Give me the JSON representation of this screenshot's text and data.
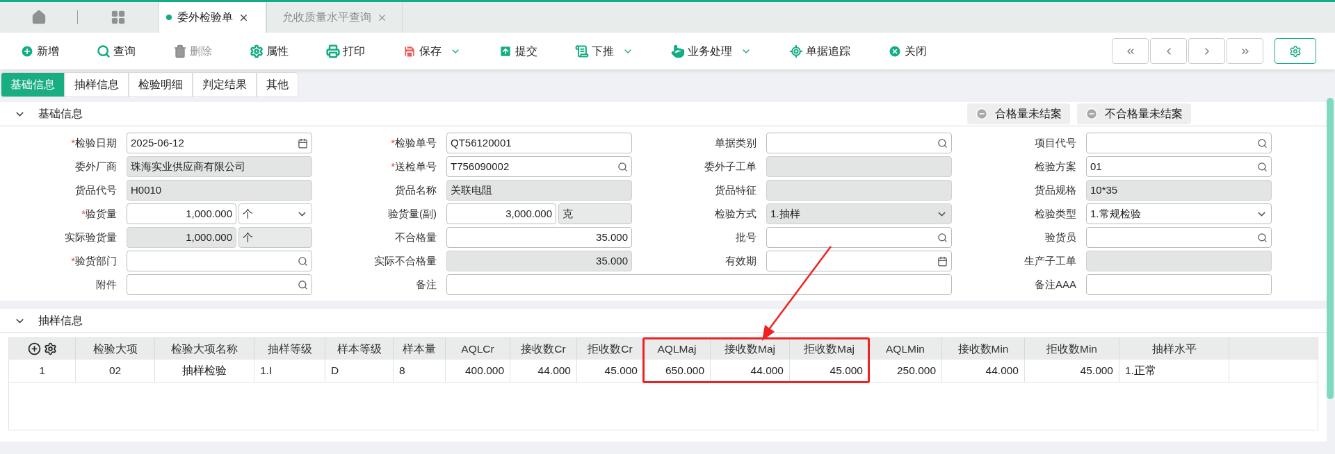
{
  "tabs": [
    {
      "label": "委外检验单",
      "selected": true,
      "closable": true
    },
    {
      "label": "允收质量水平查询",
      "selected": false,
      "closable": true
    }
  ],
  "toolbar": [
    {
      "label": "新增",
      "disabled": false,
      "dropdown": false
    },
    {
      "label": "查询",
      "disabled": false,
      "dropdown": false
    },
    {
      "label": "删除",
      "disabled": true,
      "dropdown": false
    },
    {
      "label": "属性",
      "disabled": false,
      "dropdown": false
    },
    {
      "label": "打印",
      "disabled": false,
      "dropdown": false
    },
    {
      "label": "保存",
      "disabled": false,
      "dropdown": true
    },
    {
      "label": "提交",
      "disabled": false,
      "dropdown": false
    },
    {
      "label": "下推",
      "disabled": false,
      "dropdown": true
    },
    {
      "label": "业务处理",
      "disabled": false,
      "dropdown": true
    },
    {
      "label": "单据追踪",
      "disabled": false,
      "dropdown": false
    },
    {
      "label": "关闭",
      "disabled": false,
      "dropdown": false
    }
  ],
  "subtabs": [
    {
      "label": "基础信息",
      "selected": true
    },
    {
      "label": "抽样信息",
      "selected": false
    },
    {
      "label": "检验明细",
      "selected": false
    },
    {
      "label": "判定结果",
      "selected": false
    },
    {
      "label": "其他",
      "selected": false
    }
  ],
  "basic_section": {
    "title": "基础信息",
    "expanded": true,
    "badges": [
      "合格量未结案",
      "不合格量未结案"
    ],
    "fields": [
      {
        "label": "检验日期",
        "required_mark": "*",
        "kind": "date",
        "readonly": false,
        "value": "2025-06-12"
      },
      {
        "label": "检验单号",
        "required_mark": "*",
        "kind": "text",
        "readonly": false,
        "value": "QT56120001"
      },
      {
        "label": "单据类别",
        "kind": "search",
        "readonly": false
      },
      {
        "label": "项目代号",
        "kind": "search",
        "readonly": false
      },
      {
        "label": "委外厂商",
        "kind": "text",
        "readonly": true,
        "value": "珠海实业供应商有限公司"
      },
      {
        "label": "送检单号",
        "required_mark": "*",
        "kind": "search",
        "readonly": false,
        "value": "T756090002"
      },
      {
        "label": "委外子工单",
        "kind": "text",
        "readonly": true
      },
      {
        "label": "检验方案",
        "kind": "search",
        "readonly": false,
        "value": "01"
      },
      {
        "label": "货品代号",
        "kind": "text",
        "readonly": true,
        "value": "H0010"
      },
      {
        "label": "货品名称",
        "kind": "text",
        "readonly": true,
        "value": "关联电阻"
      },
      {
        "label": "货品特征",
        "kind": "text",
        "readonly": true
      },
      {
        "label": "货品规格",
        "kind": "text",
        "readonly": true,
        "value": "10*35"
      },
      {
        "label": "验货量",
        "required_mark": "*",
        "kind": "quantity",
        "readonly": false,
        "value": "1,000.000",
        "unit": "个",
        "unit_dropdown": true
      },
      {
        "label": "验货量(副)",
        "kind": "quantity",
        "readonly": false,
        "value": "3,000.000",
        "unit": "克",
        "unit_dropdown": false
      },
      {
        "label": "检验方式",
        "kind": "select",
        "readonly": true,
        "value": "1.抽样"
      },
      {
        "label": "检验类型",
        "kind": "select",
        "readonly": false,
        "value": "1.常规检验"
      },
      {
        "label": "实际验货量",
        "kind": "quantity",
        "readonly": true,
        "value": "1,000.000",
        "unit": "个",
        "unit_dropdown": false
      },
      {
        "label": "不合格量",
        "kind": "number",
        "readonly": false,
        "value": "35.000"
      },
      {
        "label": "批号",
        "kind": "search",
        "readonly": false
      },
      {
        "label": "验货员",
        "kind": "search",
        "readonly": false
      },
      {
        "label": "验货部门",
        "required_mark": "*",
        "kind": "search",
        "readonly": false
      },
      {
        "label": "实际不合格量",
        "kind": "number",
        "readonly": true,
        "value": "35.000"
      },
      {
        "label": "有效期",
        "kind": "date",
        "readonly": false
      },
      {
        "label": "生产子工单",
        "kind": "text",
        "readonly": true
      },
      {
        "label": "附件",
        "kind": "search",
        "readonly": false
      },
      {
        "label": "备注",
        "kind": "wide",
        "readonly": false
      },
      {
        "label": "备注AAA",
        "kind": "text",
        "readonly": false
      }
    ]
  },
  "sampling_section": {
    "title": "抽样信息",
    "expanded": true,
    "table": {
      "columns": [
        {
          "label": "检验大项",
          "highlighted": false
        },
        {
          "label": "检验大项名称",
          "highlighted": false
        },
        {
          "label": "抽样等级",
          "highlighted": false
        },
        {
          "label": "样本等级",
          "highlighted": false
        },
        {
          "label": "样本量",
          "highlighted": false
        },
        {
          "label": "AQLCr",
          "highlighted": false
        },
        {
          "label": "接收数Cr",
          "highlighted": false
        },
        {
          "label": "拒收数Cr",
          "highlighted": false
        },
        {
          "label": "AQLMaj",
          "highlighted": true
        },
        {
          "label": "接收数Maj",
          "highlighted": true
        },
        {
          "label": "拒收数Maj",
          "highlighted": true
        },
        {
          "label": "AQLMin",
          "highlighted": false
        },
        {
          "label": "接收数Min",
          "highlighted": false
        },
        {
          "label": "拒收数Min",
          "highlighted": false
        },
        {
          "label": "抽样水平",
          "highlighted": false
        }
      ],
      "rows": [
        {
          "index": "1",
          "cells": [
            "02",
            "抽样检验",
            "1.I",
            "D",
            "8",
            "400.000",
            "44.000",
            "45.000",
            "650.000",
            "44.000",
            "45.000",
            "250.000",
            "44.000",
            "45.000",
            "1.正常"
          ]
        }
      ]
    }
  }
}
